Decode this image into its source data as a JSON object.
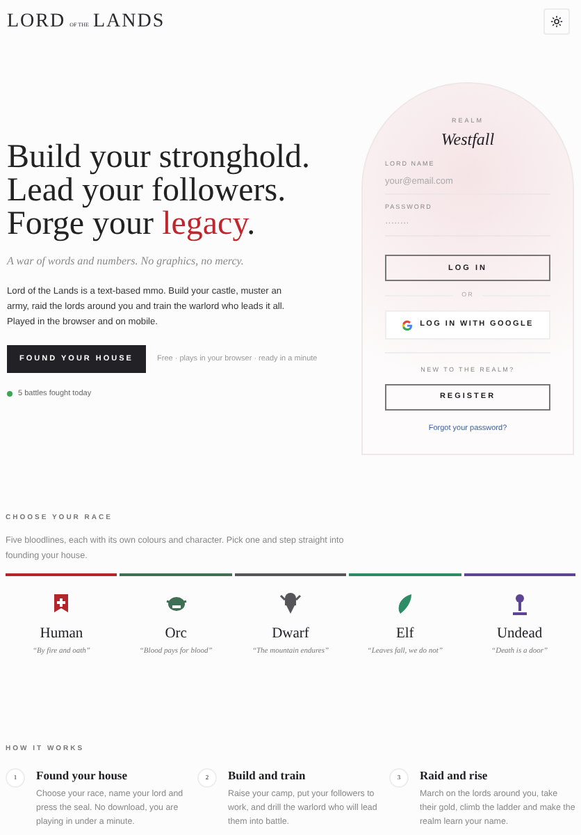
{
  "header": {
    "logo": {
      "first": "LORD",
      "middle": "OF THE",
      "last": "LANDS"
    }
  },
  "hero": {
    "title_lines": [
      "Build your stronghold.",
      "Lead your followers.",
      "Forge your **legacy**."
    ],
    "tagline": "A war of words and numbers. No graphics, no mercy.",
    "description": "Lord of the Lands is a text-based mmo. Build your castle, muster an army, raid the lords around you and train the warlord who leads it all. Played in the browser and on mobile.",
    "cta": "FOUND YOUR HOUSE",
    "cta_note": "Free · plays in your browser · ready in a minute",
    "status": {
      "text": "5 battles fought today",
      "color": "#3aa757"
    }
  },
  "login": {
    "realm_label": "REALM",
    "realm": "Westfall",
    "fields": [
      {
        "label": "LORD NAME",
        "placeholder": "your@email.com"
      },
      {
        "label": "PASSWORD",
        "placeholder": "········"
      }
    ],
    "login_button": "LOG IN",
    "or": "OR",
    "google_button": "LOG IN WITH GOOGLE",
    "new_label": "NEW TO THE REALM?",
    "register_button": "REGISTER",
    "forgot": "Forgot your password?"
  },
  "races": {
    "heading": "CHOOSE YOUR RACE",
    "intro": "Five bloodlines, each with its own colours and character. Pick one and step straight into founding your house.",
    "items": [
      {
        "name": "Human",
        "quote": "“By fire and oath”",
        "color": "#b3262b"
      },
      {
        "name": "Orc",
        "quote": "“Blood pays for blood”",
        "color": "#3f6f55"
      },
      {
        "name": "Dwarf",
        "quote": "“The mountain endures”",
        "color": "#55555a"
      },
      {
        "name": "Elf",
        "quote": "“Leaves fall, we do not”",
        "color": "#2f8a66"
      },
      {
        "name": "Undead",
        "quote": "“Death is a door”",
        "color": "#5e4494"
      }
    ]
  },
  "how": {
    "heading": "HOW IT WORKS",
    "steps": [
      {
        "number": "1",
        "title": "Found your house",
        "text": "Choose your race, name your lord and press the seal. No download, you are playing in under a minute."
      },
      {
        "number": "2",
        "title": "Build and train",
        "text": "Raise your camp, put your followers to work, and drill the warlord who will lead them into battle."
      },
      {
        "number": "3",
        "title": "Raid and rise",
        "text": "March on the lords around you, take their gold, climb the ladder and make the realm learn your name."
      }
    ]
  }
}
